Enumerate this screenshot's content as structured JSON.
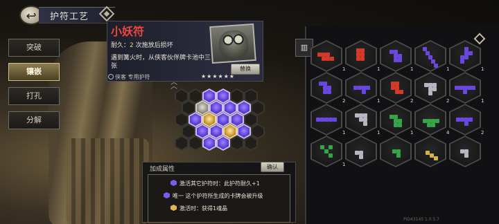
{
  "header": {
    "title": "护符工艺"
  },
  "side_menu": {
    "items": [
      {
        "label": "突破",
        "active": false
      },
      {
        "label": "镶嵌",
        "active": true
      },
      {
        "label": "打孔",
        "active": false
      },
      {
        "label": "分解",
        "active": false
      }
    ]
  },
  "detail": {
    "name": "小妖符",
    "durability_label": "耐久：",
    "durability_value": "2",
    "durability_text": "次施放后损坏",
    "effect_line1": "遇到篝火时，从侠客伙伴牌卡池中三",
    "effect_line2": "张",
    "owner_tag": "侠客 专用护符",
    "stars": "★★★★★★",
    "replace_label": "替换"
  },
  "bonus": {
    "title": "加成属性",
    "confirm_label": "确认",
    "rows": [
      {
        "text": "激活其它护符时：此护符耐久+1"
      },
      {
        "text": "唯一 这个护符所生成的卡牌会被升级"
      },
      {
        "text": "激活时：获得1魂晶"
      }
    ]
  },
  "inventory": {
    "counts": [
      "1",
      "1",
      "1",
      "1",
      "1",
      "2",
      "1",
      "2",
      "2",
      "1",
      "1",
      "1",
      "1",
      "4",
      "2",
      "1"
    ]
  },
  "colors": {
    "accent_gold": "#c9a24a",
    "purple_gem": "#6140d6",
    "red_gem": "#d23a2a",
    "green_gem": "#36a54a",
    "grey_gem": "#b8b6c2"
  },
  "footer": {
    "version": "PID43145 1.0.5.7"
  }
}
